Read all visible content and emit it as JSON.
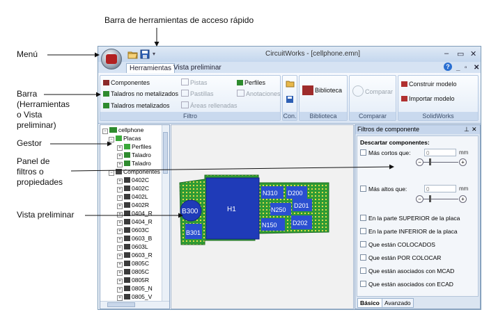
{
  "callouts": {
    "qat": "Barra de herramientas de acceso rápido",
    "menu": "Menú",
    "toolbar": [
      "Barra",
      "(Herramientas",
      "o Vista",
      "preliminar)"
    ],
    "manager": "Gestor",
    "filters": [
      "Panel de",
      "filtros o",
      "propiedades"
    ],
    "preview": "Vista preliminar"
  },
  "window": {
    "title": "CircuitWorks - [cellphone.emn]",
    "controls": {
      "minimize": "–",
      "restore": "▭",
      "close": "✕",
      "help": "?",
      "mdi_min": "_",
      "mdi_restore": "▫",
      "mdi_close": "✕"
    }
  },
  "tabs": [
    "Herramientas",
    "Vista preliminar"
  ],
  "ribbon": {
    "filtro": {
      "label": "Filtro",
      "col1": [
        "Componentes",
        "Taladros no metalizados",
        "Taladros metalizados"
      ],
      "col2": [
        "Pistas",
        "Pastillas",
        "Áreas rellenadas"
      ],
      "col3": [
        "Perfiles",
        "Anotaciones"
      ]
    },
    "con": {
      "label": "Con."
    },
    "biblioteca": {
      "label": "Biblioteca",
      "button": "Biblioteca"
    },
    "comparar": {
      "label": "Comparar",
      "button": "Comparar"
    },
    "solidworks": {
      "label": "SolidWorks",
      "buttons": [
        "Construir modelo",
        "Importar modelo"
      ]
    }
  },
  "tree": {
    "root": "cellphone",
    "placas": "Placas",
    "placas_children": [
      "Perfiles",
      "Taladro",
      "Taladro"
    ],
    "componentes": "Componentes",
    "components": [
      "0402C",
      "0402C",
      "0402L",
      "0402R",
      "0404_R",
      "0404_R",
      "0603C",
      "0603_B",
      "0603L",
      "0603_R",
      "0805C",
      "0805C",
      "0805R",
      "0805_N",
      "0805_V"
    ]
  },
  "preview": {
    "labels": [
      "H1",
      "B300",
      "B301",
      "N310",
      "D200",
      "N250",
      "D201",
      "N150",
      "D202"
    ],
    "colors": {
      "board": "#2f9b34",
      "component": "#1f3bb8",
      "label": "#ffffff"
    }
  },
  "filter_panel": {
    "title": "Filtros de componente",
    "pin": "⊥",
    "close": "✕",
    "section": "Descartar componentes:",
    "shorter": {
      "label": "Más cortos que:",
      "value": "0",
      "unit": "mm"
    },
    "taller": {
      "label": "Más altos que:",
      "value": "0",
      "unit": "mm"
    },
    "checks": [
      "En la parte SUPERIOR de la placa",
      "En la parte INFERIOR de la placa",
      "Que están COLOCADOS",
      "Que están POR COLOCAR",
      "Que están asociados con MCAD",
      "Que están asociados con ECAD"
    ],
    "tabs": [
      "Básico",
      "Avanzado"
    ]
  }
}
